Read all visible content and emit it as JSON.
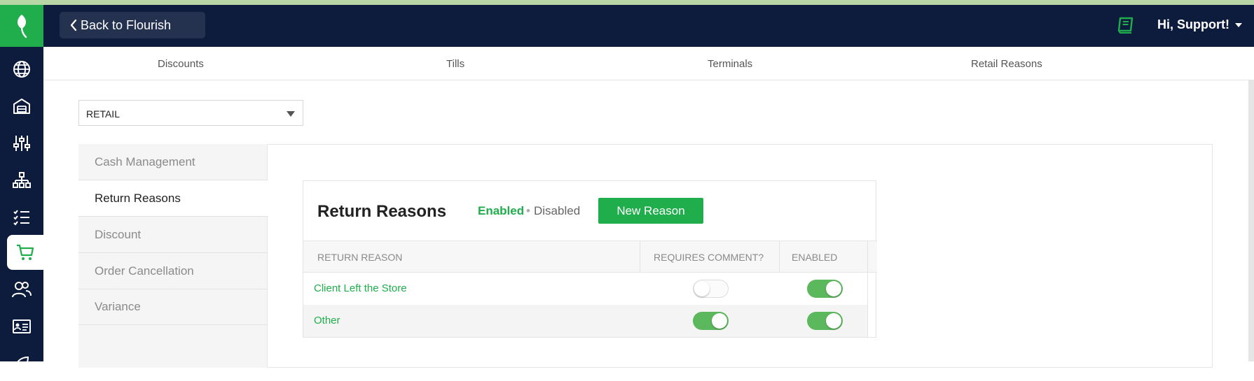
{
  "header": {
    "back_label": "Back to Flourish",
    "user_greeting": "Hi, Support!"
  },
  "subnav": {
    "items": [
      "Discounts",
      "Tills",
      "Terminals",
      "Retail Reasons"
    ]
  },
  "select": {
    "value": "RETAIL"
  },
  "tabs": {
    "items": [
      "Cash Management",
      "Return Reasons",
      "Discount",
      "Order Cancellation",
      "Variance"
    ],
    "active": "Return Reasons"
  },
  "card": {
    "title": "Return Reasons",
    "filter_enabled": "Enabled",
    "filter_separator": "•",
    "filter_disabled": "Disabled",
    "new_button": "New Reason"
  },
  "table": {
    "headers": [
      "RETURN REASON",
      "REQUIRES COMMENT?",
      "ENABLED"
    ],
    "rows": [
      {
        "reason": "Client Left the Store",
        "requires_comment": false,
        "enabled": true
      },
      {
        "reason": "Other",
        "requires_comment": true,
        "enabled": true
      }
    ]
  },
  "sidebar": {
    "icons": [
      "globe-icon",
      "warehouse-icon",
      "sliders-icon",
      "org-chart-icon",
      "checklist-icon",
      "cart-icon",
      "users-icon",
      "id-card-icon",
      "leaf-icon"
    ],
    "active": "cart-icon"
  },
  "colors": {
    "navy": "#0d1b3c",
    "green": "#1fae4b",
    "toggle_on": "#5cb85c"
  }
}
